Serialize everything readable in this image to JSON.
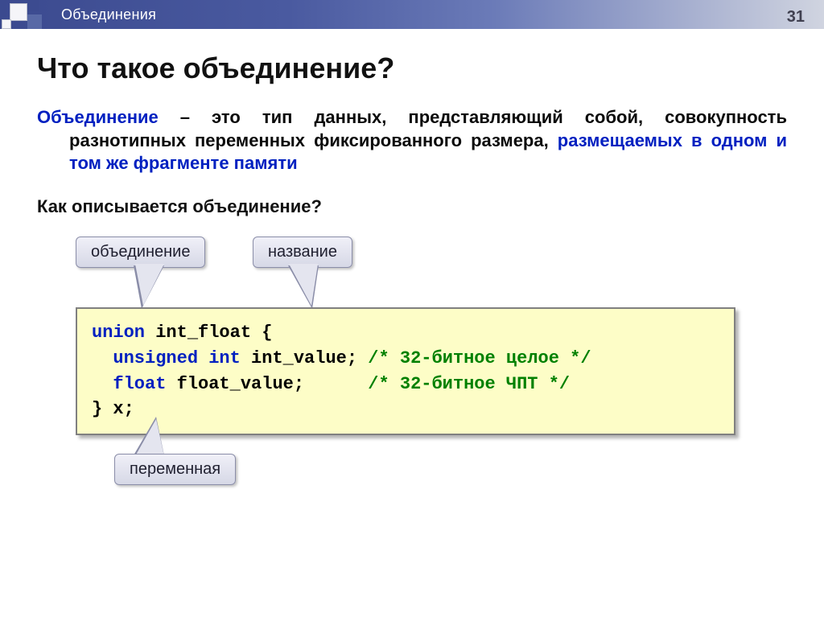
{
  "header": {
    "section_title": "Объединения",
    "page_number": "31"
  },
  "title": "Что такое объединение?",
  "definition": {
    "term": "Объединение",
    "dash": " – ",
    "body1": "это тип данных, представляющий собой, совокупность разнотипных переменных фиксированного размера, ",
    "highlight": "размещаемых в одном и том же фрагменте памяти"
  },
  "question": "Как описывается объединение?",
  "callouts": {
    "union_kw": "объединение",
    "name": "название",
    "variable": "переменная"
  },
  "code": {
    "l1_kw": "union",
    "l1_rest": " int_float {",
    "l2_kw": "  unsigned int",
    "l2_rest": " int_value; ",
    "l2_cm": "/* 32-битное целое */",
    "l3_kw": "  float",
    "l3_rest": " float_value;      ",
    "l3_cm": "/* 32-битное ЧПТ */",
    "l4": "} x;"
  }
}
